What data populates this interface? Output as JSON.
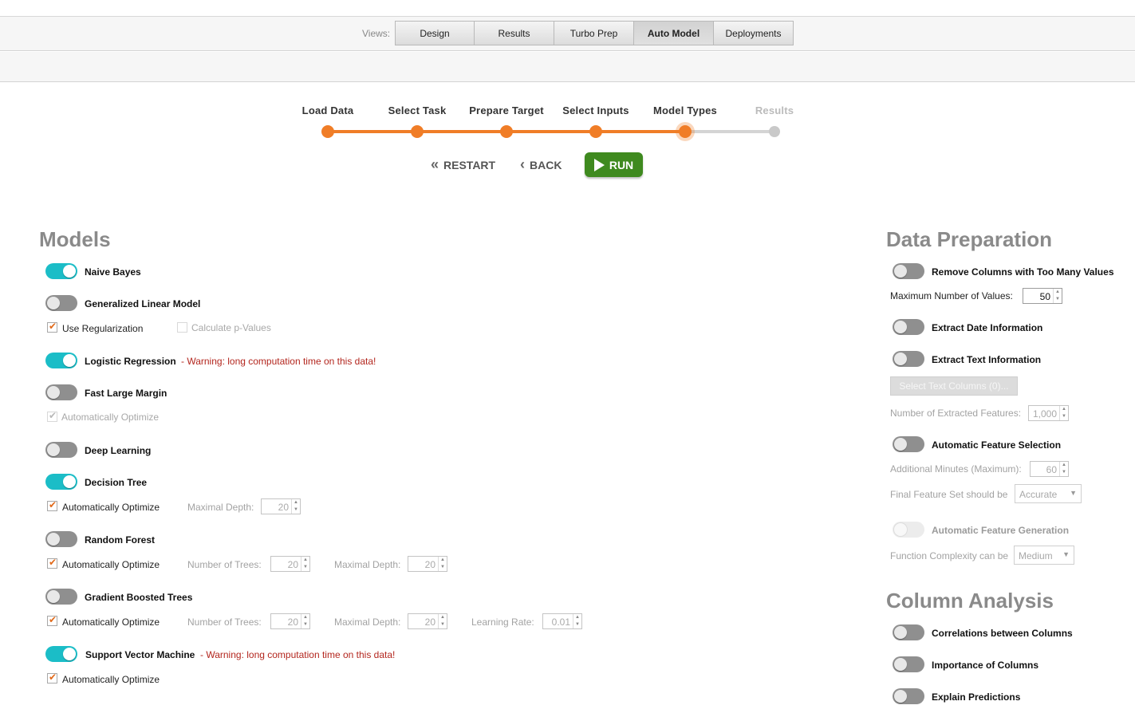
{
  "views": {
    "label": "Views:",
    "tabs": [
      {
        "label": "Design"
      },
      {
        "label": "Results"
      },
      {
        "label": "Turbo Prep"
      },
      {
        "label": "Auto Model"
      },
      {
        "label": "Deployments"
      }
    ],
    "active": "Auto Model"
  },
  "wizard": {
    "steps": [
      {
        "label": "Load Data",
        "state": "done"
      },
      {
        "label": "Select Task",
        "state": "done"
      },
      {
        "label": "Prepare Target",
        "state": "done"
      },
      {
        "label": "Select Inputs",
        "state": "done"
      },
      {
        "label": "Model Types",
        "state": "current"
      },
      {
        "label": "Results",
        "state": "todo"
      }
    ],
    "restart_label": "RESTART",
    "back_label": "BACK",
    "run_label": "RUN"
  },
  "models": {
    "title": "Models",
    "warning": "- Warning: long computation time on this data!",
    "naive_bayes": {
      "label": "Naive Bayes",
      "enabled": true
    },
    "glm": {
      "label": "Generalized Linear Model",
      "enabled": false,
      "use_regularization": "Use Regularization",
      "calc_p_values": "Calculate p-Values"
    },
    "logistic_regression": {
      "label": "Logistic Regression",
      "enabled": true
    },
    "fast_large_margin": {
      "label": "Fast Large Margin",
      "enabled": false,
      "auto_optimize": "Automatically Optimize"
    },
    "deep_learning": {
      "label": "Deep Learning",
      "enabled": false
    },
    "decision_tree": {
      "label": "Decision Tree",
      "enabled": true,
      "auto_optimize": "Automatically Optimize",
      "maximal_depth_label": "Maximal Depth:",
      "maximal_depth": "20"
    },
    "random_forest": {
      "label": "Random Forest",
      "enabled": false,
      "auto_optimize": "Automatically Optimize",
      "num_trees_label": "Number of Trees:",
      "num_trees": "20",
      "maximal_depth_label": "Maximal Depth:",
      "maximal_depth": "20"
    },
    "gbt": {
      "label": "Gradient Boosted Trees",
      "enabled": false,
      "auto_optimize": "Automatically Optimize",
      "num_trees_label": "Number of Trees:",
      "num_trees": "20",
      "maximal_depth_label": "Maximal Depth:",
      "maximal_depth": "20",
      "learning_rate_label": "Learning Rate:",
      "learning_rate": "0.01"
    },
    "svm": {
      "label": "Support Vector Machine",
      "enabled": true,
      "auto_optimize": "Automatically Optimize"
    }
  },
  "data_prep": {
    "title": "Data Preparation",
    "remove_columns": {
      "label": "Remove Columns with Too Many Values",
      "enabled": false,
      "max_values_label": "Maximum Number of Values:",
      "max_values": "50"
    },
    "extract_date": {
      "label": "Extract Date Information",
      "enabled": false
    },
    "extract_text": {
      "label": "Extract Text Information",
      "enabled": false,
      "select_columns_label": "Select Text Columns (0)...",
      "num_features_label": "Number of Extracted Features:",
      "num_features": "1,000"
    },
    "feature_selection": {
      "label": "Automatic Feature Selection",
      "enabled": false,
      "minutes_label": "Additional Minutes (Maximum):",
      "minutes": "60",
      "final_set_label": "Final Feature Set should be",
      "final_set": "Accurate"
    },
    "feature_generation": {
      "label": "Automatic Feature Generation",
      "enabled": false,
      "complexity_label": "Function Complexity can be",
      "complexity": "Medium"
    }
  },
  "column_analysis": {
    "title": "Column Analysis",
    "correlations": {
      "label": "Correlations between Columns",
      "enabled": false
    },
    "importance": {
      "label": "Importance of Columns",
      "enabled": false
    },
    "explain": {
      "label": "Explain Predictions",
      "enabled": false
    }
  },
  "colors": {
    "accent_orange": "#f07d27",
    "toggle_on": "#1bbdc7",
    "run_green": "#3f8a1f",
    "warning_red": "#b3261e"
  }
}
